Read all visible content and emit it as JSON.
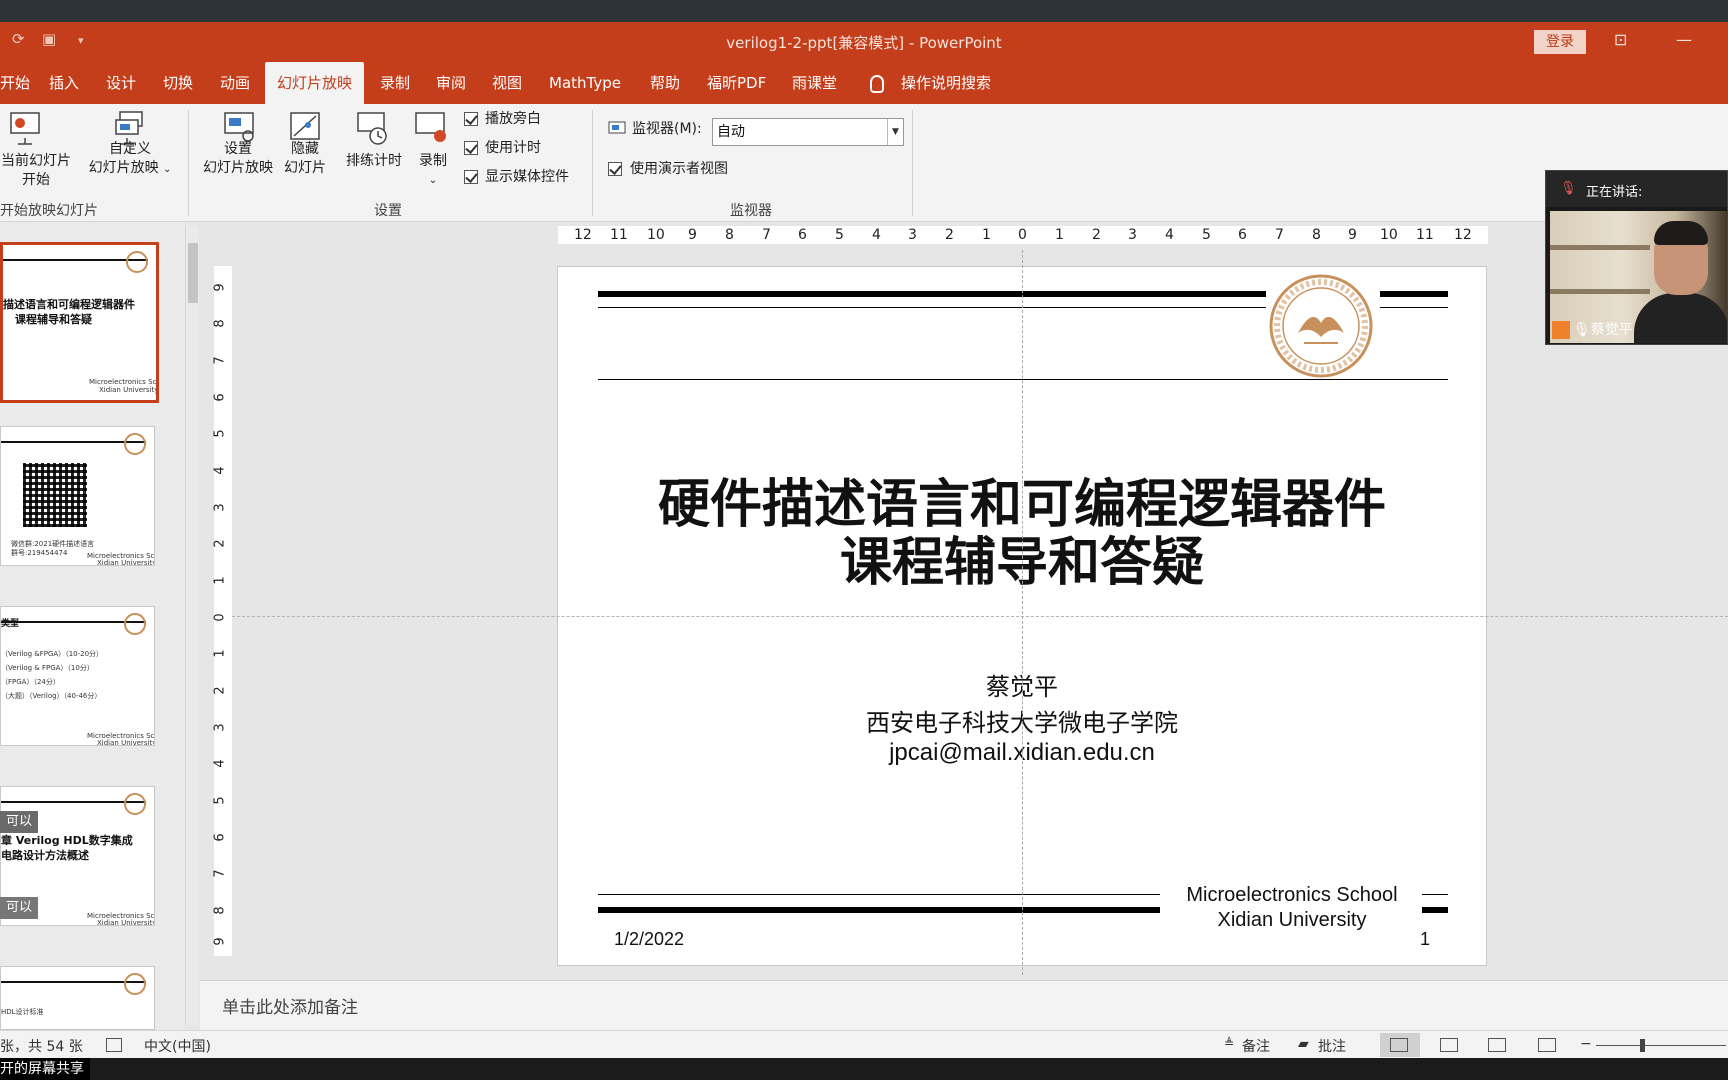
{
  "window": {
    "title": "verilog1-2-ppt[兼容模式]  -  PowerPoint",
    "login_label": "登录"
  },
  "menu": {
    "items": [
      "开始",
      "插入",
      "设计",
      "切换",
      "动画",
      "幻灯片放映",
      "录制",
      "审阅",
      "视图",
      "MathType",
      "帮助",
      "福昕PDF",
      "雨课堂"
    ],
    "active": "幻灯片放映",
    "search_hint": "操作说明搜索"
  },
  "ribbon": {
    "from_current_line1": "当前幻灯片",
    "from_current_line2": "开始",
    "custom_line1": "自定义",
    "custom_line2": "幻灯片放映",
    "group1_label": "开始放映幻灯片",
    "setup_line1": "设置",
    "setup_line2": "幻灯片放映",
    "hide_line1": "隐藏",
    "hide_line2": "幻灯片",
    "rehearse_label": "排练计时",
    "record_label": "录制",
    "chk_narration": "播放旁白",
    "chk_timing": "使用计时",
    "chk_media": "显示媒体控件",
    "group2_label": "设置",
    "monitor_label": "监视器(M):",
    "monitor_value": "自动",
    "presenter_view": "使用演示者视图",
    "group3_label": "监视器"
  },
  "thumbnails": [
    {
      "title1": "描述语言和可编程逻辑器件",
      "title2": "课程辅导和答疑",
      "footer1": "Microelectronics School",
      "footer2": "Xidian University"
    },
    {
      "caption": "微信群:2021硬件描述语言",
      "caption2": "群号:219454474",
      "footer1": "Microelectronics School",
      "footer2": "Xidian University"
    },
    {
      "heading": "类型",
      "lines": [
        "（Verilog &FPGA）（10-20分）",
        "（Verilog & FPGA）（10分）",
        "（FPGA）（24分）",
        "（大题）（Verilog）（40-46分）"
      ],
      "footer1": "Microelectronics School",
      "footer2": "Xidian University"
    },
    {
      "title1": "章 Verilog HDL数字集成",
      "title2": "电路设计方法概述",
      "footer1": "Microelectronics School",
      "footer2": "Xidian University"
    },
    {
      "caption": "HDL设计标准"
    }
  ],
  "chips": {
    "chip1": "可以",
    "chip2": "可以"
  },
  "ruler": {
    "h_ticks": [
      "12",
      "11",
      "10",
      "9",
      "8",
      "7",
      "6",
      "5",
      "4",
      "3",
      "2",
      "1",
      "0",
      "1",
      "2",
      "3",
      "4",
      "5",
      "6",
      "7",
      "8",
      "9",
      "10",
      "11",
      "12"
    ],
    "v_ticks": [
      "9",
      "8",
      "7",
      "6",
      "5",
      "4",
      "3",
      "2",
      "1",
      "0",
      "1",
      "2",
      "3",
      "4",
      "5",
      "6",
      "7",
      "8",
      "9"
    ]
  },
  "slide": {
    "title_line1": "硬件描述语言和可编程逻辑器件",
    "title_line2": "课程辅导和答疑",
    "author": "蔡觉平",
    "affiliation": "西安电子科技大学微电子学院",
    "email": "jpcai@mail.xidian.edu.cn",
    "footer_line1": "Microelectronics School",
    "footer_line2": "Xidian University",
    "date": "1/2/2022",
    "page_number": "1"
  },
  "notes_placeholder": "单击此处添加备注",
  "status": {
    "slide_count": "张，共 54 张",
    "language": "中文(中国)",
    "notes_btn": "备注",
    "comments_btn": "批注"
  },
  "video": {
    "speaking_label": "正在讲话:",
    "participant_name": "蔡觉平"
  },
  "share_tip": "开的屏幕共享",
  "colors": {
    "accent": "#c43e1c",
    "seal": "#c8905a"
  }
}
